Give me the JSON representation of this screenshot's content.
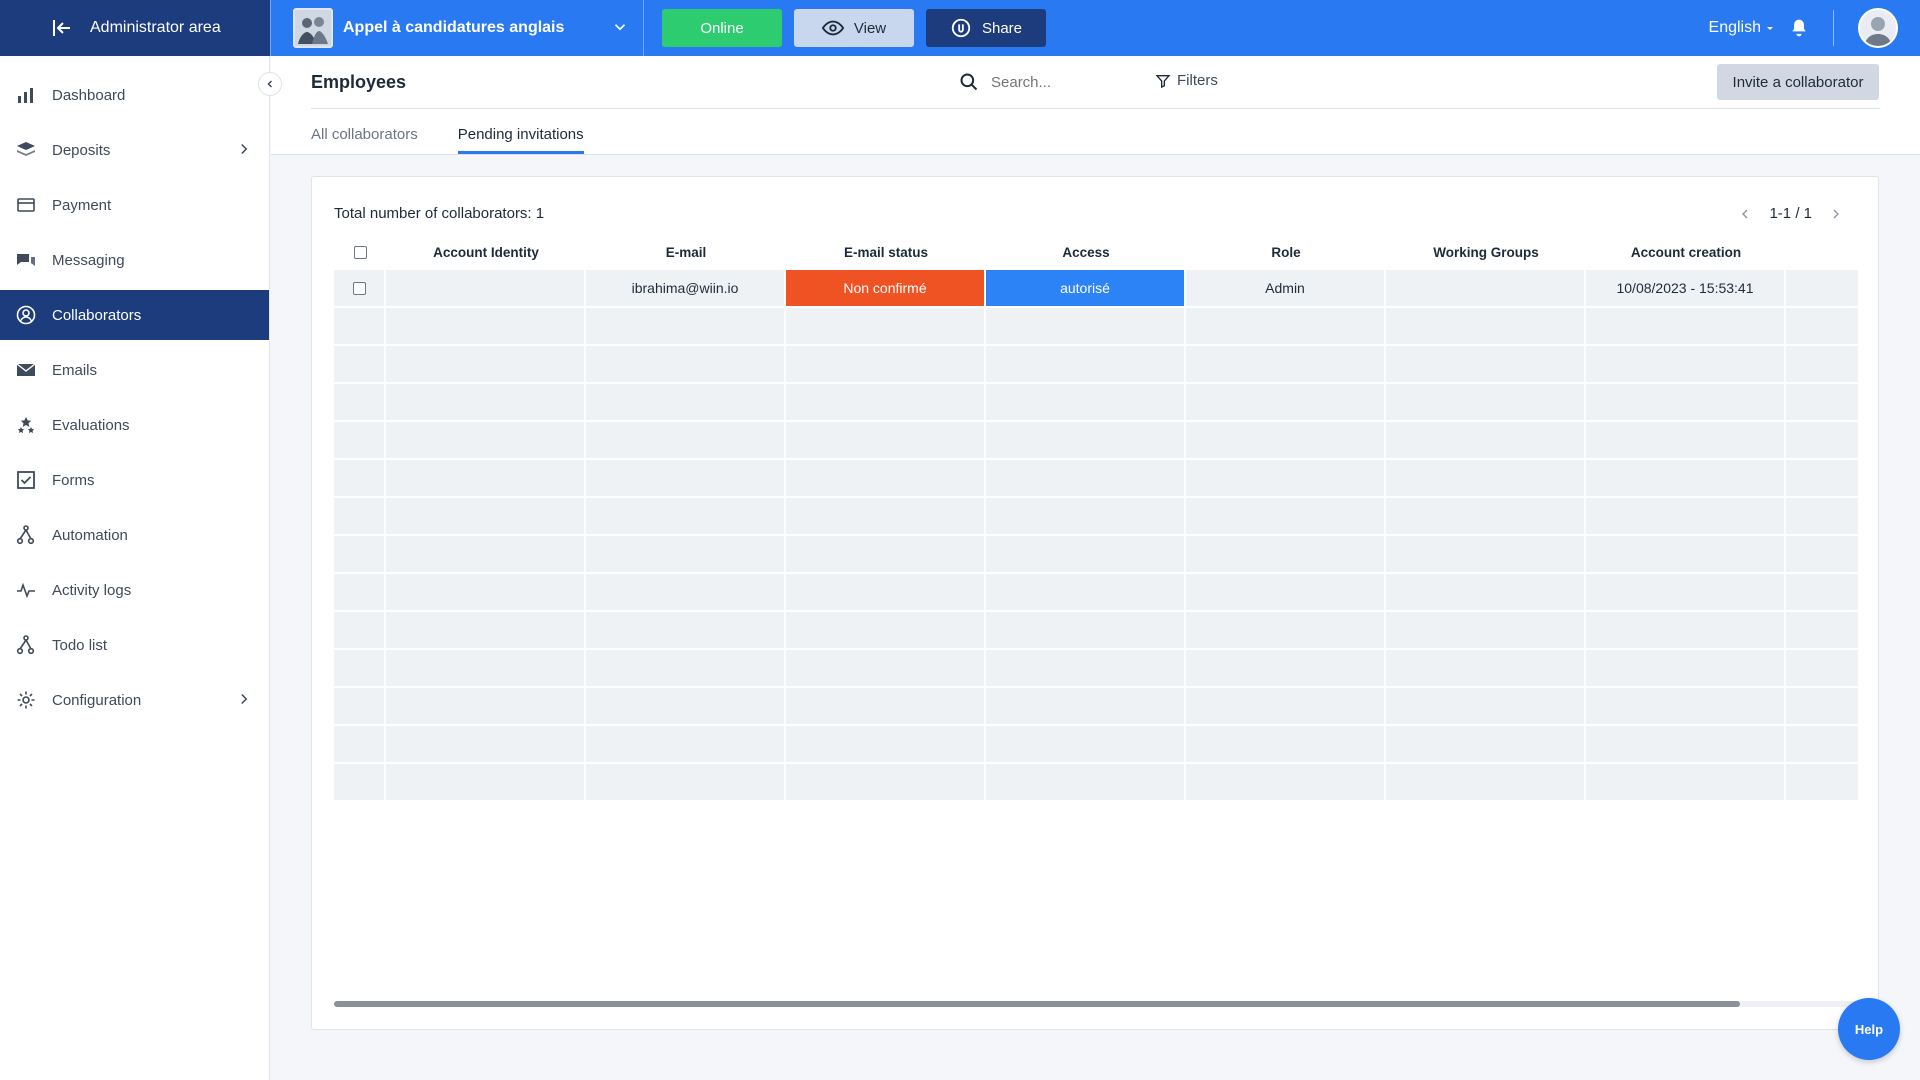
{
  "topbar": {
    "admin_label": "Administrator area",
    "project_name": "Appel à candidatures anglais",
    "online_label": "Online",
    "view_label": "View",
    "share_label": "Share",
    "language": "English"
  },
  "sidebar": {
    "items": [
      {
        "label": "Dashboard",
        "icon": "bar-chart-icon"
      },
      {
        "label": "Deposits",
        "icon": "layers-icon"
      },
      {
        "label": "Payment",
        "icon": "credit-card-icon"
      },
      {
        "label": "Messaging",
        "icon": "chat-icon"
      },
      {
        "label": "Collaborators",
        "icon": "user-circle-icon"
      },
      {
        "label": "Emails",
        "icon": "envelope-icon"
      },
      {
        "label": "Evaluations",
        "icon": "stars-icon"
      },
      {
        "label": "Forms",
        "icon": "checkbox-icon"
      },
      {
        "label": "Automation",
        "icon": "automation-icon"
      },
      {
        "label": "Activity logs",
        "icon": "pulse-icon"
      },
      {
        "label": "Todo list",
        "icon": "todo-icon"
      },
      {
        "label": "Configuration",
        "icon": "gear-icon"
      }
    ],
    "active_index": 4
  },
  "header": {
    "title": "Employees",
    "search_placeholder": "Search...",
    "filters_label": "Filters",
    "invite_label": "Invite a collaborator",
    "tabs": [
      {
        "label": "All collaborators"
      },
      {
        "label": "Pending invitations"
      }
    ],
    "active_tab": 1
  },
  "card": {
    "total_label": "Total number of collaborators: 1",
    "pager": "1-1 / 1",
    "columns": [
      "Account Identity",
      "E-mail",
      "E-mail status",
      "Access",
      "Role",
      "Working Groups",
      "Account creation"
    ],
    "rows": [
      {
        "identity": "",
        "email": "ibrahima@wiin.io",
        "email_status": "Non confirmé",
        "access": "autorisé",
        "role": "Admin",
        "groups": "",
        "created": "10/08/2023 - 15:53:41"
      }
    ],
    "empty_rows": 13
  },
  "help_label": "Help",
  "colors": {
    "primary": "#2979f2",
    "navy": "#1c3c7d",
    "online": "#2ecc71",
    "status_unconfirmed": "#f05323",
    "access_authorized": "#2b83f5"
  }
}
